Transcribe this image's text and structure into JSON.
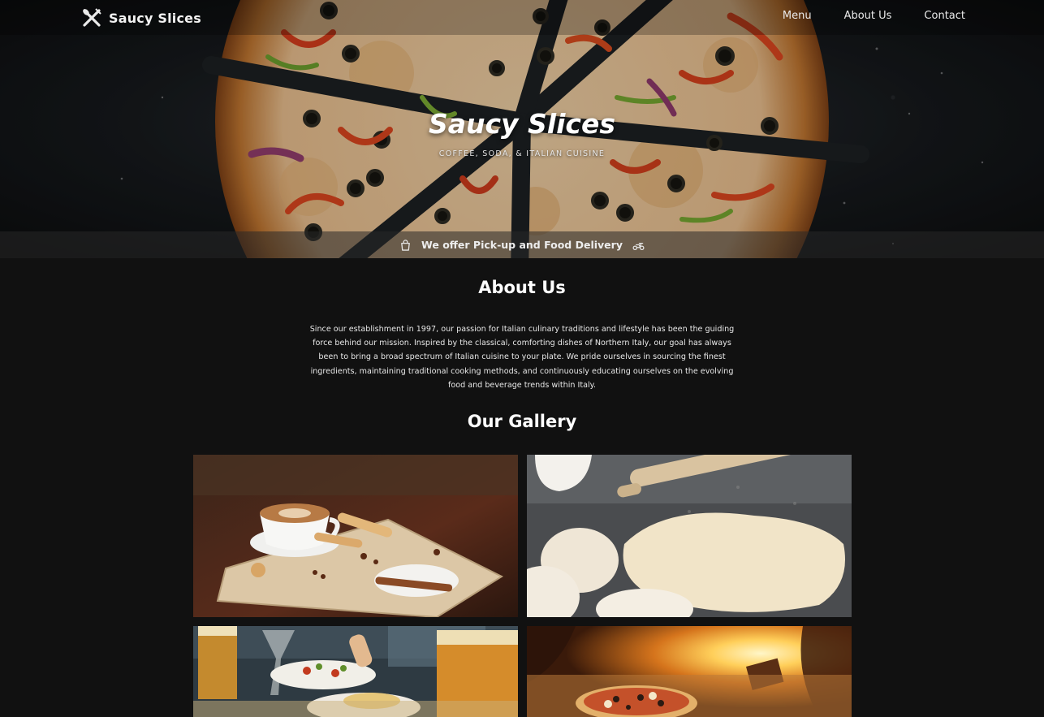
{
  "navbar": {
    "brand_name": "Saucy Slices",
    "brand_icon": "fork-knife-crossed-icon",
    "links": [
      "Menu",
      "About Us",
      "Contact"
    ]
  },
  "hero": {
    "title": "Saucy Slices",
    "subtitle": "COFFEE, SODA, & ITALIAN CUISINE",
    "background_image": "pizza-slices-on-dark-table"
  },
  "delivery_bar": {
    "text": "We offer Pick-up and Food Delivery",
    "left_icon": "shopping-bag-icon",
    "right_icon": "scooter-icon"
  },
  "about": {
    "title": "About Us",
    "text": "Since our establishment in 1997, our passion for Italian culinary traditions and lifestyle has been the guiding force behind our mission. Inspired by the classical, comforting dishes of Northern Italy, our goal has always been to bring a broad spectrum of Italian cuisine to your plate. We pride ourselves in sourcing the finest ingredients, maintaining traditional cooking methods, and continuously educating ourselves on the evolving food and beverage trends within Italy."
  },
  "gallery": {
    "title": "Our Gallery",
    "images": [
      "cappuccino-with-biscotti-and-spices",
      "pizza-dough-with-rolling-pin",
      "table-with-beers-and-appetizers",
      "pizza-in-wood-fired-oven"
    ]
  },
  "colors": {
    "page_background": "#111111",
    "text": "#ffffff",
    "delivery_bar": "#282828"
  }
}
